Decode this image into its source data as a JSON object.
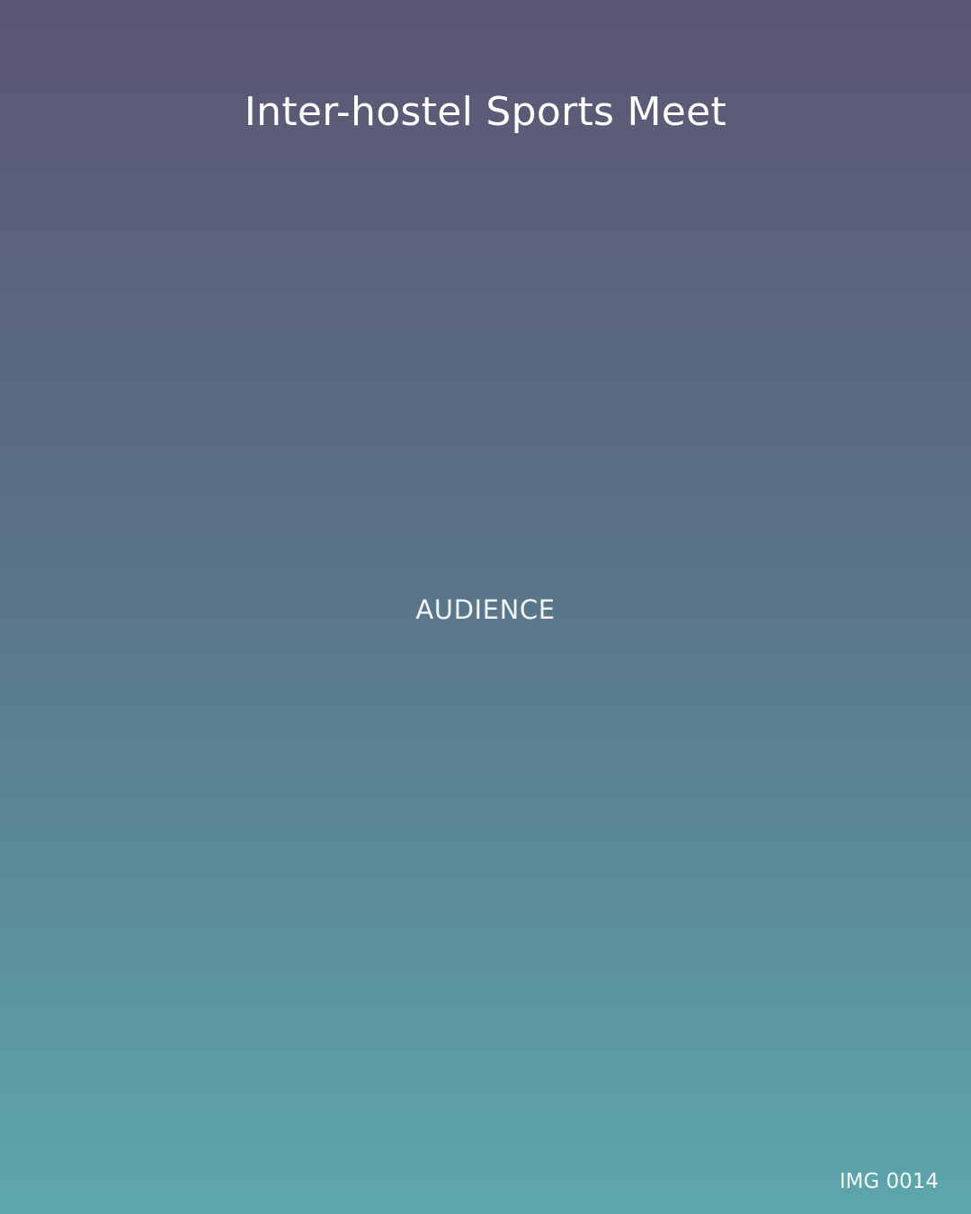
{
  "title": "Inter-hostel Sports Meet",
  "center_label": "AUDIENCE",
  "image_label": "IMG 0014",
  "colors": {
    "gradient_top": "#5b5573",
    "gradient_middle": "#5a7489",
    "gradient_bottom": "#5da6ad",
    "text": "#ffffff"
  }
}
